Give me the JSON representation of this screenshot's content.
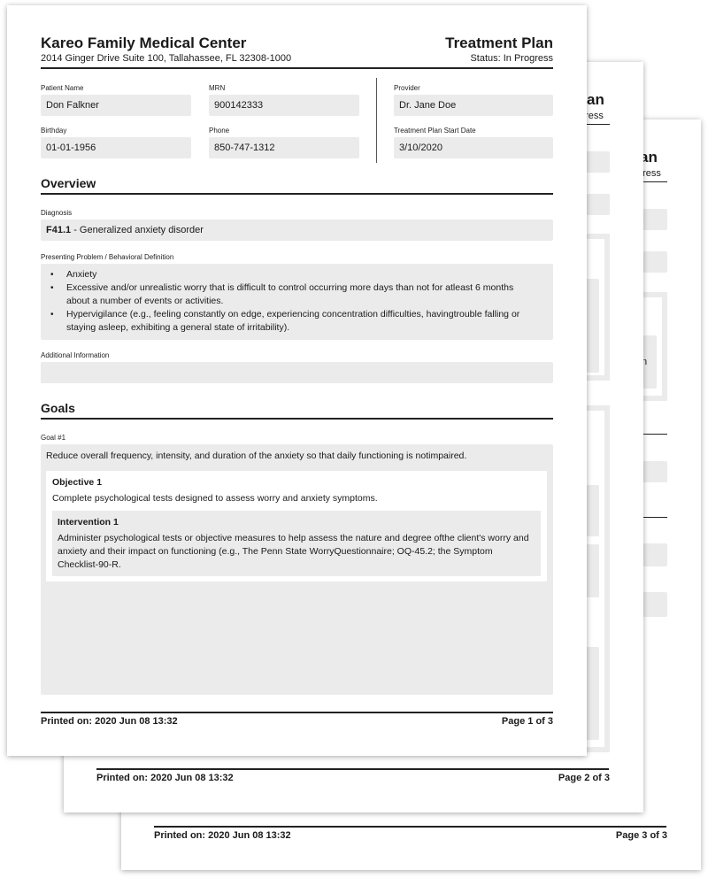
{
  "header": {
    "org_name": "Kareo Family Medical Center",
    "org_address": "2014 Ginger Drive Suite 100, Tallahassee, FL 32308-1000",
    "doc_title": "Treatment Plan",
    "status": "Status: In Progress"
  },
  "patient": {
    "name_label": "Patient Name",
    "name": "Don Falkner",
    "mrn_label": "MRN",
    "mrn": "900142333",
    "provider_label": "Provider",
    "provider": "Dr. Jane Doe",
    "birthday_label": "Birthday",
    "birthday": "01-01-1956",
    "phone_label": "Phone",
    "phone": "850-747-1312",
    "start_label": "Treatment Plan Start Date",
    "start": "3/10/2020"
  },
  "overview": {
    "heading": "Overview",
    "diagnosis_label": "Diagnosis",
    "diagnosis_code": "F41.1",
    "diagnosis_text": " - Generalized anxiety disorder",
    "problem_label": "Presenting Problem /  Behavioral Definition",
    "problems": [
      "Anxiety",
      "Excessive and/or unrealistic worry that is difficult to control occurring more days than not for atleast 6 months about a number of events or activities.",
      "Hypervigilance (e.g., feeling constantly on edge, experiencing concentration difficulties, havingtrouble falling or staying asleep, exhibiting a general state of irritability)."
    ],
    "additional_label": "Additional Information",
    "additional": ""
  },
  "goals": {
    "heading": "Goals",
    "goal_label": "Goal #1",
    "goal_text": "Reduce overall frequency, intensity, and duration of the anxiety so that daily functioning is notimpaired.",
    "objective_title": "Objective 1",
    "objective_text": "Complete psychological tests designed to assess worry and anxiety symptoms.",
    "intervention_title": "Intervention 1",
    "intervention_text": "Administer psychological tests or objective measures to help assess the nature and degree ofthe client's worry and anxiety and their impact on functioning (e.g., The Penn State WorryQuestionnaire; OQ-45.2; the Symptom Checklist-90-R."
  },
  "pages": [
    {
      "printed": "Printed on: 2020 Jun 08 13:32",
      "page": "Page 1 of 3"
    },
    {
      "printed": "Printed on: 2020 Jun 08 13:32",
      "page": "Page 2 of 3"
    },
    {
      "printed": "Printed on: 2020 Jun 08 13:32",
      "page": "Page 3 of 3"
    }
  ],
  "back_fragments": {
    "p2_title": "Plan",
    "p2_status": "gress",
    "p3_title": "Plan",
    "p3_status": "gress",
    "p3_frag": "n"
  }
}
